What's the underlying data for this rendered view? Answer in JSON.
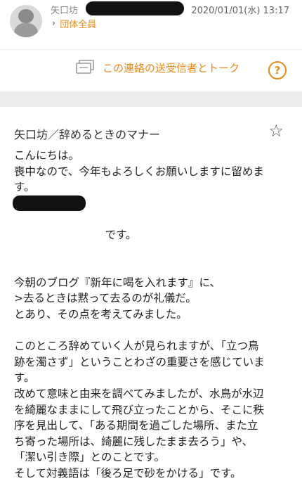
{
  "header": {
    "sender_name": "矢口坊",
    "datetime": "2020/01/01(水) 13:17",
    "group_label": "団体全員"
  },
  "talk_bar": {
    "label": "この連絡の送受信者とトーク",
    "help_glyph": "?"
  },
  "message": {
    "title": "矢口坊／辞めるときのマナー",
    "star_glyph": "☆",
    "lines": [
      "こんにちは。",
      "喪中なので、今年もよろしくお願いしますに留めま",
      "す。",
      "です。",
      "",
      "今朝のブログ『新年に喝を入れます』に、",
      ">去るときは黙って去るのが礼儀だ。",
      "とあり、その点を考えてみました。",
      "",
      "このところ辞めていく人が見られますが、「立つ鳥",
      "跡を濁さず」ということわざの重要さを感じていま",
      "す。",
      "改めて意味と由来を調べてみましたが、水鳥が水辺",
      "を綺麗なままにして飛び立ったことから、そこに秩",
      "序を見出して、「ある期間を過ごした場所、また立",
      "ち寄った場所は、綺麗に残したまま去ろう」や、",
      "「潔い引き際」とのことです。",
      "そして対義語は「後ろ足で砂をかける」です。"
    ]
  },
  "colors": {
    "accent": "#e88a1a",
    "separator": "#ececec"
  }
}
